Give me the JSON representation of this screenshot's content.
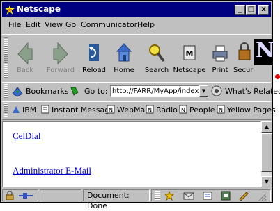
{
  "window": {
    "title": "Netscape",
    "controls": {
      "minimize": "_",
      "maximize": "□",
      "close": "x"
    }
  },
  "menu": [
    {
      "label": "File",
      "accel": "F",
      "rest": "ile"
    },
    {
      "label": "Edit",
      "accel": "E",
      "rest": "dit"
    },
    {
      "label": "View",
      "accel": "V",
      "rest": "iew"
    },
    {
      "label": "Go",
      "accel": "G",
      "rest": "o"
    },
    {
      "label": "Communicator",
      "accel": "C",
      "rest": "ommunicator"
    },
    {
      "label": "Help",
      "accel": "H",
      "rest": "elp"
    }
  ],
  "navigation": [
    {
      "label": "Back",
      "icon": "back-arrow-icon",
      "enabled": false
    },
    {
      "label": "Forward",
      "icon": "forward-arrow-icon",
      "enabled": false
    },
    {
      "label": "Reload",
      "icon": "reload-icon",
      "enabled": true
    },
    {
      "label": "Home",
      "icon": "home-icon",
      "enabled": true
    },
    {
      "label": "Search",
      "icon": "search-icon",
      "enabled": true
    },
    {
      "label": "Netscape",
      "icon": "netscape-icon",
      "enabled": true
    },
    {
      "label": "Print",
      "icon": "print-icon",
      "enabled": true
    },
    {
      "label": "Securi",
      "icon": "security-lock-icon",
      "enabled": true
    }
  ],
  "logo": {
    "letter": "N"
  },
  "location": {
    "bookmarks_label": "Bookmarks",
    "goto_label": "Go to:",
    "url": "http://FARR/MyApp/index.html",
    "whats_related": "What's Related"
  },
  "personal_toolbar": [
    {
      "label": "IBM",
      "icon": "ibm-icon"
    },
    {
      "label": "Instant Message",
      "icon": "instant-message-icon"
    },
    {
      "label": "WebMail",
      "icon": "bookmark-page-icon"
    },
    {
      "label": "Radio",
      "icon": "bookmark-page-icon"
    },
    {
      "label": "People",
      "icon": "bookmark-page-icon"
    },
    {
      "label": "Yellow Pages",
      "icon": "bookmark-page-icon"
    }
  ],
  "content": {
    "links": [
      "CelDial",
      "Administrator E-Mail"
    ]
  },
  "status": {
    "text": "Document: Done"
  },
  "colors": {
    "titlebar": "#000080",
    "link": "#0000cc",
    "chrome": "#c0c0c0",
    "marker": "#e00000"
  }
}
